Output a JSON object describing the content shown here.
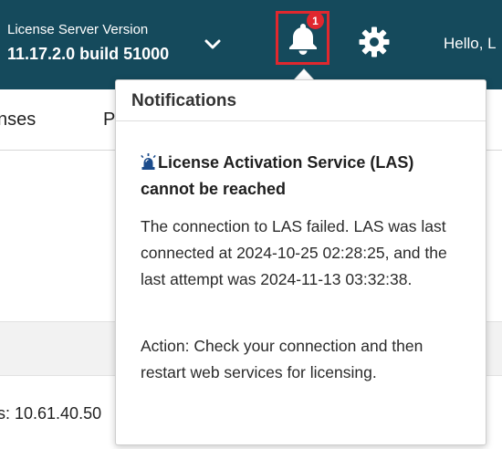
{
  "header": {
    "version_label": "License Server Version",
    "version_value": "11.17.2.0 build 51000",
    "notification_count": "1",
    "greeting": "Hello, L",
    "icons": {
      "version_toggle": "chevron-down-icon",
      "notifications": "bell-icon",
      "settings": "gear-icon"
    }
  },
  "nav": {
    "tabs": [
      {
        "label": "nses"
      },
      {
        "label": "P"
      }
    ]
  },
  "background": {
    "address_text": "s: 10.61.40.50"
  },
  "notifications": {
    "title": "Notifications",
    "items": [
      {
        "icon": "siren-icon",
        "title": "License Activation Service (LAS) cannot be reached",
        "message": "The connection to LAS failed. LAS was last connected at 2024-10-25 02:28:25, and the last attempt was 2024-11-13 03:32:38.",
        "action": "Action: Check your connection and then restart web services for licensing."
      }
    ]
  },
  "colors": {
    "header_bg": "#154a5c",
    "highlight_red": "#e0282e",
    "badge_red": "#e0282e"
  }
}
